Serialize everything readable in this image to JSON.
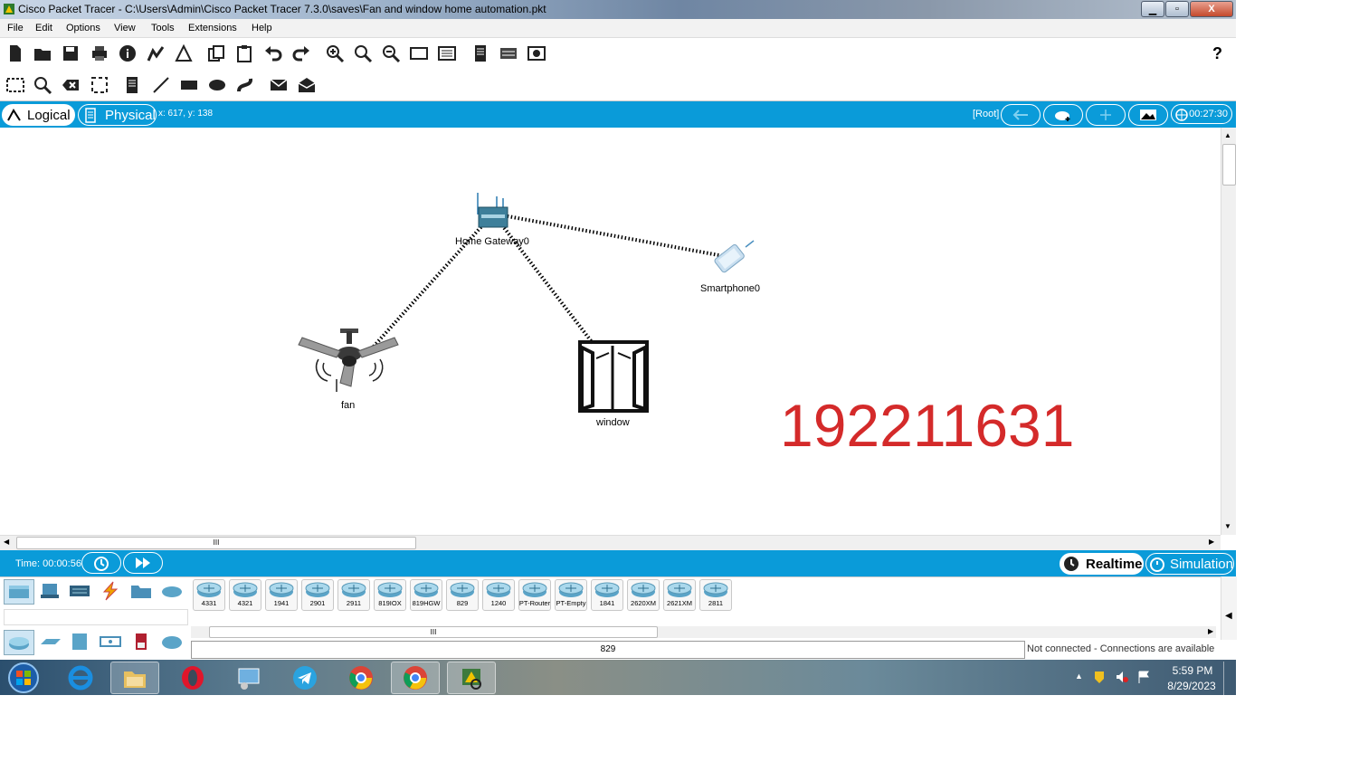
{
  "window": {
    "title": "Cisco Packet Tracer - C:\\Users\\Admin\\Cisco Packet Tracer 7.3.0\\saves\\Fan and window home automation.pkt",
    "minimize": "▁",
    "maximize": "▫",
    "close": "X"
  },
  "menu": [
    "File",
    "Edit",
    "Options",
    "View",
    "Tools",
    "Extensions",
    "Help"
  ],
  "toolbar": {
    "help": "?"
  },
  "view": {
    "logical": "Logical",
    "physical": "Physical",
    "coords": "x: 617, y: 138",
    "root": "[Root]",
    "clock": "00:27:30"
  },
  "devices": {
    "gateway": "Home Gateway0",
    "smartphone": "Smartphone0",
    "fan": "fan",
    "window": "window"
  },
  "watermark": "192211631",
  "timebar": {
    "time": "Time: 00:00:56",
    "realtime": "Realtime",
    "simulation": "Simulation"
  },
  "scrollbar_grip": "III",
  "router_models": [
    "4331",
    "4321",
    "1941",
    "2901",
    "2911",
    "819IOX",
    "819HGW",
    "829",
    "1240",
    "PT-Router",
    "PT-Empty",
    "1841",
    "2620XM",
    "2621XM",
    "2811"
  ],
  "selected_model": "829",
  "status": "Not connected - Connections are available",
  "tray": {
    "time": "5:59 PM",
    "date": "8/29/2023"
  },
  "colors": {
    "accent": "#0a9bd9",
    "watermark": "#d42a2a"
  }
}
